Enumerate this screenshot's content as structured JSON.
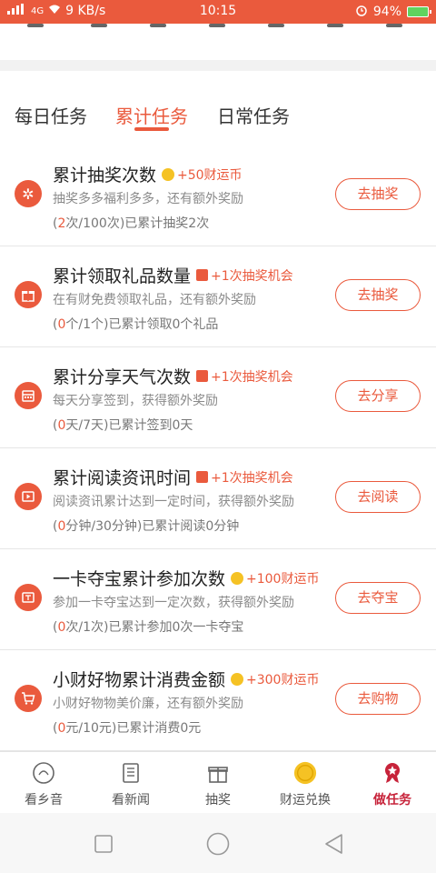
{
  "status_bar": {
    "signal": "4G",
    "network_speed": "9 KB/s",
    "time": "10:15",
    "battery": "94%"
  },
  "tabs": [
    {
      "label": "每日任务",
      "active": false
    },
    {
      "label": "累计任务",
      "active": true
    },
    {
      "label": "日常任务",
      "active": false
    }
  ],
  "tasks": [
    {
      "icon": "lottery-wheel-icon",
      "title": "累计抽奖次数",
      "reward_icon": "coin-icon",
      "reward": "+50财运币",
      "desc": "抽奖多多福利多多，还有额外奖励",
      "progress_open": "(",
      "progress_value": "2",
      "progress_rest": "次/100次)已累计抽奖2次",
      "button": "去抽奖"
    },
    {
      "icon": "gift-icon",
      "title": "累计领取礼品数量",
      "reward_icon": "gift-ticket-icon",
      "reward": "+1次抽奖机会",
      "desc": "在有财免费领取礼品，还有额外奖励",
      "progress_open": "(",
      "progress_value": "0",
      "progress_rest": "个/1个)已累计领取0个礼品",
      "button": "去抽奖"
    },
    {
      "icon": "calendar-icon",
      "title": "累计分享天气次数",
      "reward_icon": "gift-ticket-icon",
      "reward": "+1次抽奖机会",
      "desc": "每天分享签到，获得额外奖励",
      "progress_open": "(",
      "progress_value": "0",
      "progress_rest": "天/7天)已累计签到0天",
      "button": "去分享"
    },
    {
      "icon": "video-icon",
      "title": "累计阅读资讯时间",
      "reward_icon": "gift-ticket-icon",
      "reward": "+1次抽奖机会",
      "desc": "阅读资讯累计达到一定时间，获得额外奖励",
      "progress_open": "(",
      "progress_value": "0",
      "progress_rest": "分钟/30分钟)已累计阅读0分钟",
      "button": "去阅读"
    },
    {
      "icon": "treasure-icon",
      "title": "一卡夺宝累计参加次数",
      "reward_icon": "coin-icon",
      "reward": "+100财运币",
      "desc": "参加一卡夺宝达到一定次数，获得额外奖励",
      "progress_open": "(",
      "progress_value": "0",
      "progress_rest": "次/1次)已累计参加0次一卡夺宝",
      "button": "去夺宝"
    },
    {
      "icon": "cart-icon",
      "title": "小财好物累计消费金额",
      "reward_icon": "coin-icon",
      "reward": "+300财运币",
      "desc": "小财好物物美价廉，还有额外奖励",
      "progress_open": "(",
      "progress_value": "0",
      "progress_rest": "元/10元)已累计消费0元",
      "button": "去购物"
    }
  ],
  "bottom_nav": [
    {
      "label": "看乡音",
      "icon": "radio-icon",
      "active": false
    },
    {
      "label": "看新闻",
      "icon": "news-icon",
      "active": false
    },
    {
      "label": "抽奖",
      "icon": "gift-box-icon",
      "active": false
    },
    {
      "label": "财运兑换",
      "icon": "gold-coin-icon",
      "active": false
    },
    {
      "label": "做任务",
      "icon": "medal-icon",
      "active": true
    }
  ],
  "colors": {
    "accent": "#ea5a3d",
    "active_nav": "#c7233a",
    "coin": "#f5c224"
  }
}
